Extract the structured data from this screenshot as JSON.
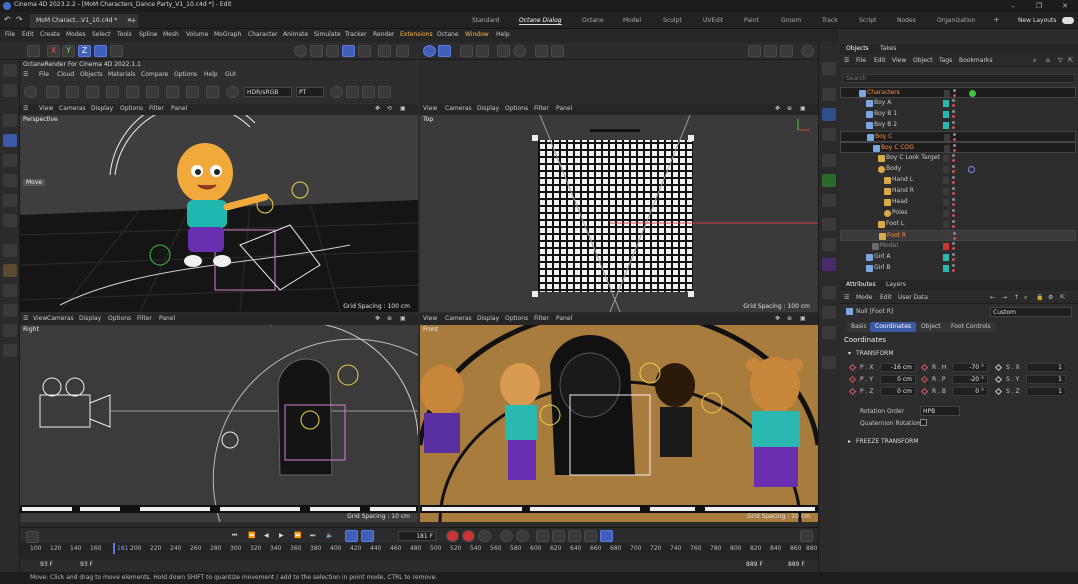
{
  "window": {
    "title": "Cinema 4D 2023.2.2 - [MoM Characters_Dance Party_V1_10.c4d *] - Edit",
    "doc_tab": "MoM Charact...V1_10.c4d *",
    "layouts": [
      "Standard",
      "Octane Dialog",
      "Octane",
      "Model",
      "Sculpt",
      "UVEdit",
      "Paint",
      "Groom",
      "Track",
      "Script",
      "Nodes",
      "Organization"
    ],
    "active_layout": "Octane Dialog",
    "new_layouts": "New Layouts"
  },
  "menu": [
    "File",
    "Edit",
    "Create",
    "Modes",
    "Select",
    "Tools",
    "Spline",
    "Mesh",
    "Volume",
    "MoGraph",
    "Character",
    "Animate",
    "Simulate",
    "Tracker",
    "Render",
    "Extensions",
    "Octane",
    "Window",
    "Help"
  ],
  "octane": {
    "title": "OctaneRender For Cinema 4D 2022.1.1",
    "menu": [
      "File",
      "Cloud",
      "Objects",
      "Materials",
      "Compare",
      "Options",
      "Help",
      "GUI"
    ],
    "color_mode": "HDR/sRGB",
    "kernel": "PT"
  },
  "viewport_menu": [
    "View",
    "Cameras",
    "Display",
    "Options",
    "Filter",
    "Panel"
  ],
  "viewports": {
    "perspective": {
      "label": "Perspective",
      "grid": "Grid Spacing : 100 cm",
      "hud_move": "Move"
    },
    "top": {
      "label": "Top",
      "grid": "Grid Spacing : 100 cm"
    },
    "right": {
      "label": "Right",
      "grid": "Grid Spacing : 10 cm"
    },
    "front": {
      "label": "Front",
      "grid": "Grid Spacing : 10 cm"
    }
  },
  "timeline": {
    "ticks": [
      "100",
      "120",
      "140",
      "160",
      "181",
      "200",
      "220",
      "240",
      "260",
      "280",
      "300",
      "320",
      "340",
      "360",
      "380",
      "400",
      "420",
      "440",
      "460",
      "480",
      "500",
      "520",
      "540",
      "560",
      "580",
      "600",
      "620",
      "640",
      "660",
      "680",
      "700",
      "720",
      "740",
      "760",
      "780",
      "800",
      "820",
      "840",
      "860",
      "880"
    ],
    "current_frame": "181 F",
    "start_a": "93 F",
    "start_b": "93 F",
    "end_a": "889 F",
    "end_b": "889 F"
  },
  "status": "Move: Click and drag to move elements. Hold down SHIFT to quantize movement / add to the selection in point mode, CTRL to remove.",
  "objects_panel": {
    "tabs": [
      "Objects",
      "Takes"
    ],
    "menu": [
      "File",
      "Edit",
      "View",
      "Object",
      "Tags",
      "Bookmarks"
    ],
    "search_placeholder": "Search",
    "rows": [
      {
        "name": "Characters",
        "indent": 0,
        "color": "#e24b4b",
        "sel": true
      },
      {
        "name": "Boy A",
        "indent": 1,
        "color": "#c9c9c9"
      },
      {
        "name": "Boy B 1",
        "indent": 1,
        "color": "#c9c9c9"
      },
      {
        "name": "Boy B 2",
        "indent": 1,
        "color": "#c9c9c9"
      },
      {
        "name": "Boy C",
        "indent": 1,
        "color": "#e24b4b",
        "sel": true
      },
      {
        "name": "Boy C COG",
        "indent": 2,
        "color": "#e24b4b",
        "sel": true
      },
      {
        "name": "Boy C Look Target",
        "indent": 3,
        "color": "#c9c9c9"
      },
      {
        "name": "Body",
        "indent": 3,
        "color": "#c9c9c9"
      },
      {
        "name": "Hand L",
        "indent": 4,
        "color": "#c9c9c9"
      },
      {
        "name": "Hand R",
        "indent": 4,
        "color": "#c9c9c9"
      },
      {
        "name": "Head",
        "indent": 4,
        "color": "#c9c9c9"
      },
      {
        "name": "Poles",
        "indent": 4,
        "color": "#c9c9c9"
      },
      {
        "name": "Foot L",
        "indent": 3,
        "color": "#c9c9c9"
      },
      {
        "name": "Foot R",
        "indent": 3,
        "color": "#ff8f40",
        "sel": true
      },
      {
        "name": "Model",
        "indent": 2,
        "color": "#8a8a8a"
      },
      {
        "name": "Girl A",
        "indent": 1,
        "color": "#c9c9c9"
      },
      {
        "name": "Girl B",
        "indent": 1,
        "color": "#c9c9c9"
      }
    ]
  },
  "attributes_panel": {
    "tabs": [
      "Attributes",
      "Layers"
    ],
    "menu": [
      "Mode",
      "Edit",
      "User Data"
    ],
    "object_name": "Null [Foot R]",
    "preset": "Custom",
    "sub_tabs": [
      "Basic",
      "Coordinates",
      "Object",
      "Foot Controls"
    ],
    "active_sub_tab": "Coordinates",
    "section_title": "Coordinates",
    "transform_group": "TRANSFORM",
    "fields": {
      "px_label": "P . X",
      "px": "-16 cm",
      "py_label": "P . Y",
      "py": "0 cm",
      "pz_label": "P . Z",
      "pz": "0 cm",
      "rh_label": "R . H",
      "rh": "-70 °",
      "rp_label": "R . P",
      "rp": "-20 °",
      "rb_label": "R . B",
      "rb": "0 °",
      "sx_label": "S . X",
      "sx": "1",
      "sy_label": "S . Y",
      "sy": "1",
      "sz_label": "S . Z",
      "sz": "1"
    },
    "rotation_order_label": "Rotation Order",
    "rotation_order": "HPB",
    "quaternion_label": "Quaternion Rotation",
    "freeze_group": "FREEZE TRANSFORM"
  },
  "colors": {
    "accent": "#3b5aa6",
    "selection": "#ff8f40",
    "red": "#e24b4b",
    "teal": "#2bb8b0"
  }
}
